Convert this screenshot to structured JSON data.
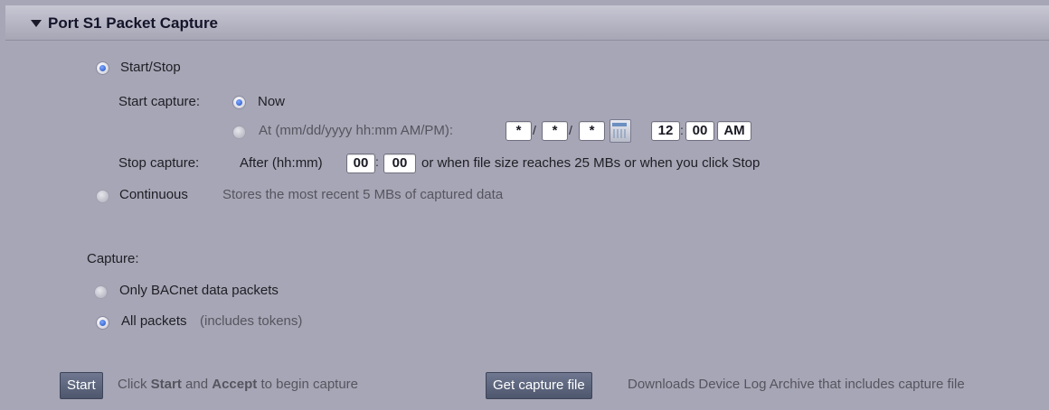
{
  "header": {
    "title": "Port S1 Packet Capture"
  },
  "mode": {
    "start_stop_label": "Start/Stop",
    "start_capture_label": "Start capture:",
    "now_label": "Now",
    "at_label": "At (mm/dd/yyyy hh:mm AM/PM):",
    "date": {
      "month": "*",
      "day": "*",
      "year": "*"
    },
    "time": {
      "hour": "12",
      "minute": "00",
      "ampm": "AM"
    },
    "date_sep": "/",
    "time_sep": ":",
    "stop_capture_label": "Stop capture:",
    "after_label": "After (hh:mm)",
    "after_hours": "00",
    "after_minutes": "00",
    "stop_tail": "or when file size reaches 25 MBs or when you click Stop",
    "continuous_label": "Continuous",
    "continuous_desc": "Stores the most recent 5 MBs of captured data",
    "selected": "start_stop",
    "start_selected": "now"
  },
  "capture": {
    "heading": "Capture:",
    "bacnet_label": "Only BACnet data packets",
    "all_label": "All packets",
    "all_desc": "(includes tokens)",
    "selected": "all"
  },
  "footer": {
    "start_button": "Start",
    "hint_pre": "Click",
    "hint_start": "Start",
    "hint_and": "and",
    "hint_accept": "Accept",
    "hint_post": "to begin capture",
    "get_file_button": "Get capture file",
    "get_file_desc": "Downloads Device Log Archive that includes capture file"
  },
  "colors": {
    "panel_bg": "#a7a6b6",
    "button_bg": "#56607a",
    "radio_selected": "#1f4fc0"
  }
}
